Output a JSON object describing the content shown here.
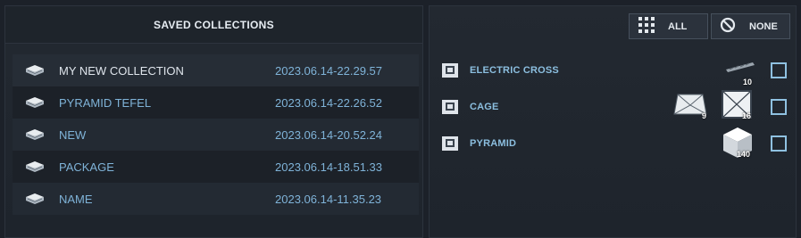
{
  "left_panel": {
    "title": "SAVED COLLECTIONS",
    "collections": [
      {
        "name": "MY NEW COLLECTION",
        "date": "2023.06.14-22.29.57"
      },
      {
        "name": "PYRAMID TEFEL",
        "date": "2023.06.14-22.26.52"
      },
      {
        "name": "NEW",
        "date": "2023.06.14-20.52.24"
      },
      {
        "name": "PACKAGE",
        "date": "2023.06.14-18.51.33"
      },
      {
        "name": "NAME",
        "date": "2023.06.14-11.35.23"
      }
    ]
  },
  "right_panel": {
    "buttons": {
      "all_label": "ALL",
      "none_label": "NONE"
    },
    "items": [
      {
        "name": "ELECTRIC CROSS",
        "counts": [
          "10"
        ]
      },
      {
        "name": "CAGE",
        "counts": [
          "9",
          "16"
        ]
      },
      {
        "name": "PYRAMID",
        "counts": [
          "140"
        ]
      }
    ]
  },
  "colors": {
    "accent": "#8fc1e1",
    "background": "#1c2129",
    "text": "#d6dde6"
  }
}
